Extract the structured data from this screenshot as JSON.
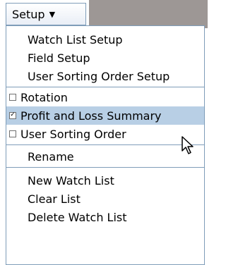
{
  "menu_button": {
    "label": "Setup",
    "caret_icon": "caret-down-icon"
  },
  "menu": {
    "items": [
      {
        "label": "Watch List Setup"
      },
      {
        "label": "Field Setup"
      },
      {
        "label": "User Sorting Order Setup"
      },
      {
        "label": "Rotation",
        "checked": false
      },
      {
        "label": "Profit and Loss Summary",
        "checked": true,
        "highlighted": true
      },
      {
        "label": "User Sorting Order",
        "checked": false
      },
      {
        "label": "Rename"
      },
      {
        "label": "New Watch List"
      },
      {
        "label": "Clear List"
      },
      {
        "label": "Delete Watch List"
      }
    ]
  },
  "colors": {
    "highlight": "#b8cfe5",
    "border": "#7f9db9",
    "menubar_gray": "#9d9795"
  },
  "cursor_icon": "arrow-pointer-icon"
}
